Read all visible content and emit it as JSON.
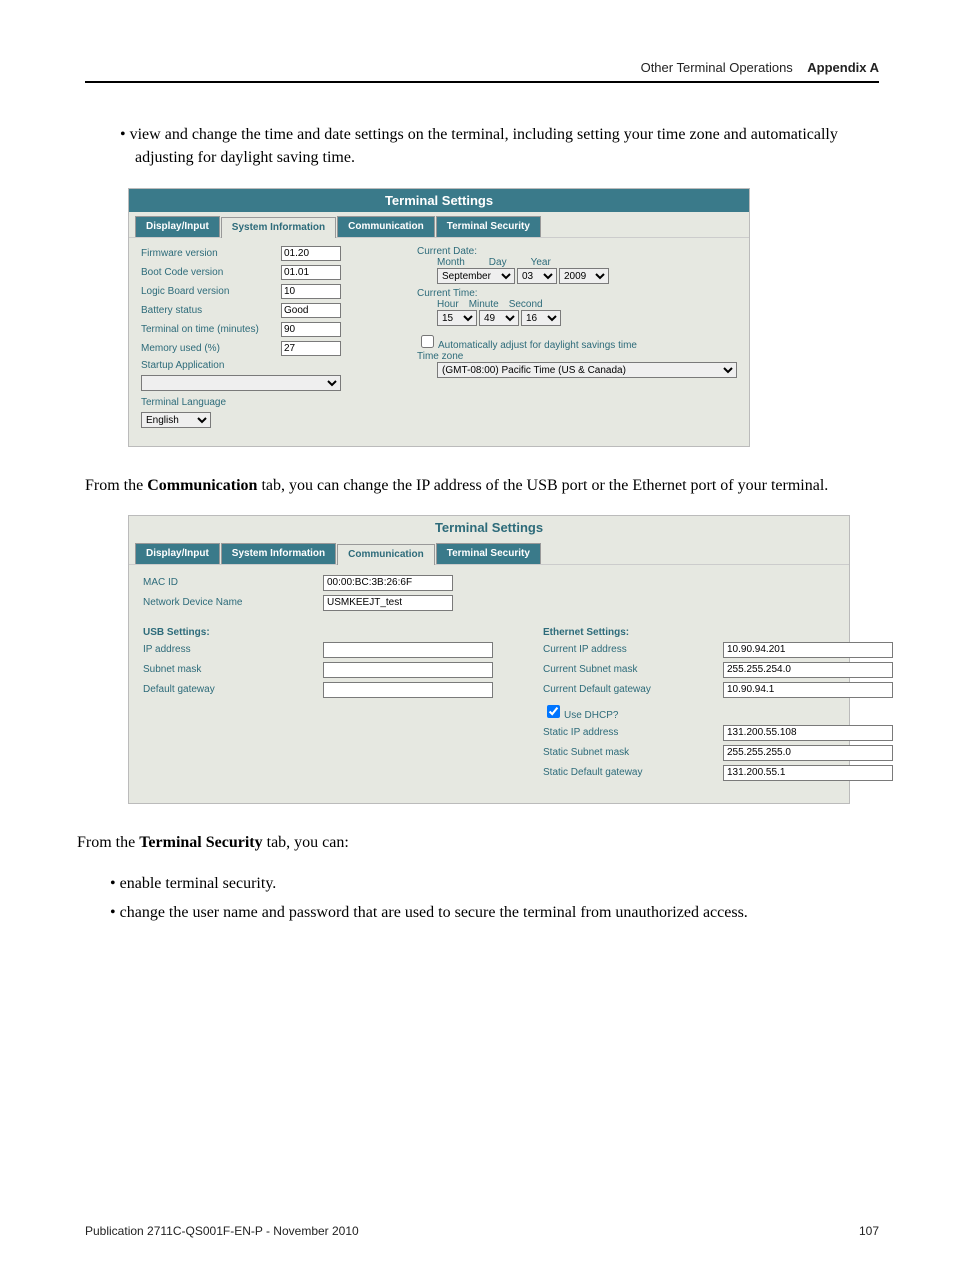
{
  "header": {
    "section": "Other Terminal Operations",
    "appendix": "Appendix A"
  },
  "intro_bullet": "view and change the time and date settings on the terminal, including setting your time zone and automatically adjusting for daylight saving time.",
  "panel1": {
    "title": "Terminal Settings",
    "tabs": {
      "display_input": "Display/Input",
      "system_info": "System Information",
      "communication": "Communication",
      "terminal_security": "Terminal Security"
    },
    "left": {
      "firmware": {
        "label": "Firmware version",
        "value": "01.20"
      },
      "bootcode": {
        "label": "Boot Code version",
        "value": "01.01"
      },
      "logic": {
        "label": "Logic Board version",
        "value": "10"
      },
      "battery": {
        "label": "Battery status",
        "value": "Good"
      },
      "ontime": {
        "label": "Terminal on time (minutes)",
        "value": "90"
      },
      "memory": {
        "label": "Memory used (%)",
        "value": "27"
      },
      "startup": {
        "label": "Startup Application"
      },
      "termlang": {
        "label": "Terminal Language",
        "value": "English"
      }
    },
    "right": {
      "curdate": "Current Date:",
      "month": "Month",
      "day": "Day",
      "year": "Year",
      "month_v": "September",
      "day_v": "03",
      "year_v": "2009",
      "curtime": "Current Time:",
      "hour": "Hour",
      "minute": "Minute",
      "second": "Second",
      "hour_v": "15",
      "minute_v": "49",
      "second_v": "16",
      "dst": "Automatically adjust for daylight savings time",
      "tz_label": "Time zone",
      "tz_value": "(GMT-08:00) Pacific Time (US & Canada)"
    }
  },
  "para1a": "From the ",
  "para1b": "Communication",
  "para1c": " tab, you can change the IP address of the USB port or the Ethernet port of your terminal.",
  "panel2": {
    "title": "Terminal Settings",
    "tabs": {
      "display_input": "Display/Input",
      "system_info": "System Information",
      "communication": "Communication",
      "terminal_security": "Terminal Security"
    },
    "macid": {
      "label": "MAC ID",
      "value": "00:00:BC:3B:26:6F"
    },
    "netname": {
      "label": "Network Device Name",
      "value": "USMKEEJT_test"
    },
    "usb": {
      "heading": "USB Settings:",
      "ip": {
        "label": "IP address",
        "value": ""
      },
      "mask": {
        "label": "Subnet mask",
        "value": ""
      },
      "gw": {
        "label": "Default gateway",
        "value": ""
      }
    },
    "eth": {
      "heading": "Ethernet Settings:",
      "curip": {
        "label": "Current IP address",
        "value": "10.90.94.201"
      },
      "curmask": {
        "label": "Current Subnet mask",
        "value": "255.255.254.0"
      },
      "curgw": {
        "label": "Current Default gateway",
        "value": "10.90.94.1"
      },
      "dhcp": "Use DHCP?",
      "staticip": {
        "label": "Static IP address",
        "value": "131.200.55.108"
      },
      "staticmask": {
        "label": "Static Subnet mask",
        "value": "255.255.255.0"
      },
      "staticgw": {
        "label": "Static Default gateway",
        "value": "131.200.55.1"
      }
    }
  },
  "para2a": "From the ",
  "para2b": "Terminal Security",
  "para2c": " tab, you can:",
  "bullets2": {
    "a": "enable terminal security.",
    "b": "change the user name and password that are used to secure the terminal from unauthorized access."
  },
  "footer": {
    "pub": "Publication 2711C-QS001F-EN-P - November 2010",
    "page": "107"
  }
}
